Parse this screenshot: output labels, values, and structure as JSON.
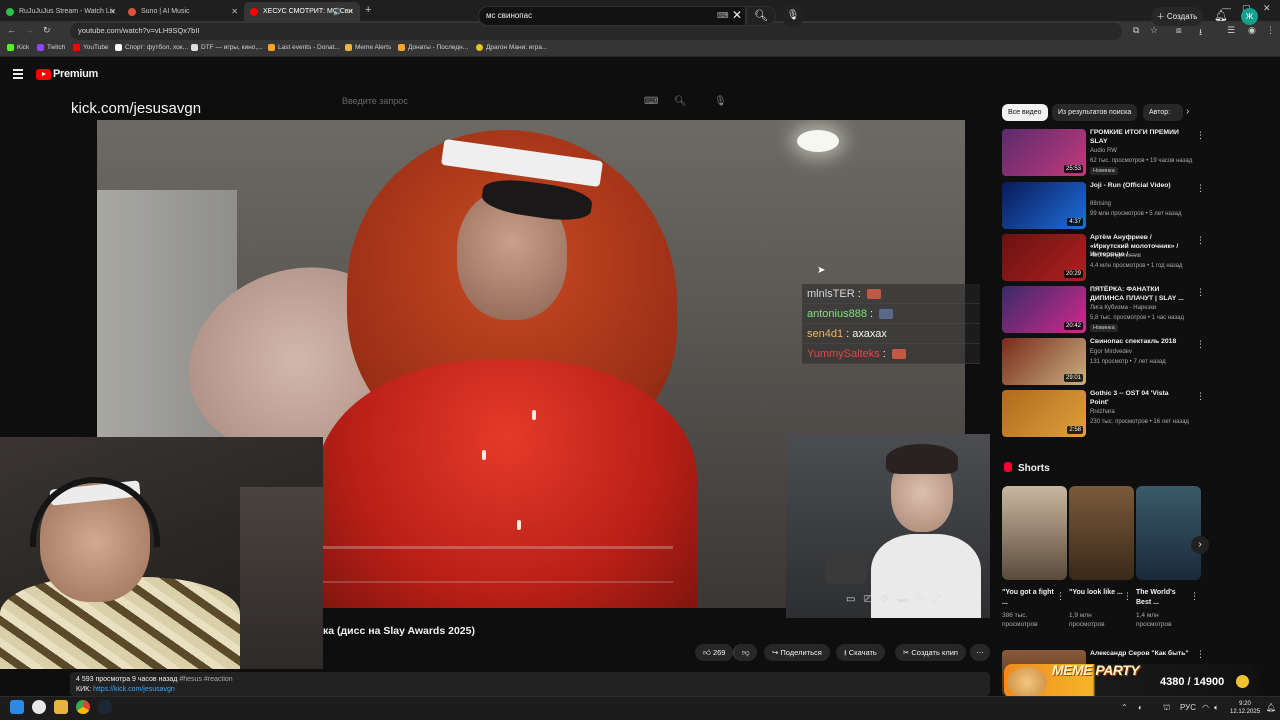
{
  "browser": {
    "tabs": [
      {
        "title": "RuJuJuJus Stream - Watch Liv",
        "color": "#2fbf4a"
      },
      {
        "title": "Suno | AI Music",
        "color": "#e0533a"
      },
      {
        "title": "ХЕСУС СМОТРИТ: МС Сви",
        "color": "#ff0000"
      }
    ],
    "url": "youtube.com/watch?v=vLH9SQx7bII",
    "bookmarks": [
      "Kick",
      "Twitch",
      "YouTube",
      "Спорт: футбол, хок...",
      "DTF — игры, кино,...",
      "Last events - Donat...",
      "Meme Alerts",
      "Донаты - Последн...",
      "Драгон Мани: игра..."
    ]
  },
  "youtube": {
    "brand": "Premium",
    "search_value": "мс свинопас",
    "create_label": "Создать",
    "avatar_letter": "Ж"
  },
  "stream": {
    "kick_label": "kick.com/jesusavgn",
    "ghost_search_placeholder": "Введите запрос",
    "chat": [
      {
        "user": "mlnlsTER",
        "msg": "",
        "color": "#d8d8d8"
      },
      {
        "user": "antonius888",
        "msg": "",
        "color": "#7ee07a"
      },
      {
        "user": "sen4d1",
        "msg": "ахахах",
        "color": "#e6b85c"
      },
      {
        "user": "YummySalteks",
        "msg": "",
        "color": "#e04848"
      }
    ]
  },
  "video": {
    "title": "ка (дисс на Slay Awards 2025)",
    "likes": "269",
    "share_label": "Поделиться",
    "download_label": "Скачать",
    "clip_label": "Создать клип",
    "views_line": "4 593 просмотра  9 часов назад",
    "hashtags": "#hesus #reaction",
    "kick_prefix": "КИК:",
    "kick_link": "https://kick.com/jesusavgn"
  },
  "chips": [
    "Все видео",
    "Из результатов поиска",
    "Автор: "
  ],
  "recommendations": [
    {
      "title": "ГРОМКИЕ ИТОГИ ПРЕМИИ SLAY",
      "channel": "Audio RW",
      "meta": "62 тыс. просмотров • 19 часов назад",
      "badge": "Новинка",
      "duration": "25:53",
      "c1": "#5a2b6e",
      "c2": "#c23a7a"
    },
    {
      "title": "Joji - Run (Official Video)",
      "channel": "88rising",
      "meta": "99 млн просмотров • 5 лет назад",
      "badge": "",
      "duration": "4:37",
      "c1": "#0a1a5a",
      "c2": "#1f6fd8"
    },
    {
      "title": "Артём Ануфриев / «Иркутский молоточник» / Интервью / ...",
      "channel": "Честный Детектив",
      "meta": "4,4 млн просмотров • 1 год назад",
      "badge": "",
      "duration": "20:29",
      "c1": "#6a1212",
      "c2": "#b02020"
    },
    {
      "title": "ПЯТЁРКА: ФАНАТКИ ДИПИНСА ПЛАЧУТ | SLAY ...",
      "channel": "Лига Кубизма - Нарезки",
      "meta": "5,8 тыс. просмотров • 1 час назад",
      "badge": "Новинка",
      "duration": "20:42",
      "c1": "#3a2a6a",
      "c2": "#d02a8a"
    },
    {
      "title": "Свинопас спектакль 2018",
      "channel": "Egor Mirdvedev",
      "meta": "131 просмотр • 7 лет назад",
      "badge": "",
      "duration": "29:01",
      "c1": "#7a2a1a",
      "c2": "#c8b080"
    },
    {
      "title": "Gothic 3 -- OST 04 'Vista Point'",
      "channel": "Rrezhara",
      "meta": "230 тыс. просмотров • 16 лет назад",
      "badge": "",
      "duration": "2:58",
      "c1": "#b06a1a",
      "c2": "#e0a040"
    }
  ],
  "shorts": {
    "header": "Shorts",
    "items": [
      {
        "title": "\"You got a fight ...",
        "views": "386 тыс. просмотров",
        "c1": "#c9b8a0",
        "c2": "#5a4a3a"
      },
      {
        "title": "\"You look like ...",
        "views": "1,9 млн просмотров",
        "c1": "#7a5a3a",
        "c2": "#3a2a1a"
      },
      {
        "title": "The World's Best ...",
        "views": "1,4 млн просмотров",
        "c1": "#3a5a6a",
        "c2": "#1a2a3a"
      }
    ]
  },
  "last_rec_title": "Александр Серов \"Как быть\"",
  "meme_party": {
    "label": "MEME PARTY",
    "score": "4380 / 14900"
  },
  "taskbar": {
    "lang": "РУС",
    "time": "9:20",
    "date": "12.12.2025"
  }
}
